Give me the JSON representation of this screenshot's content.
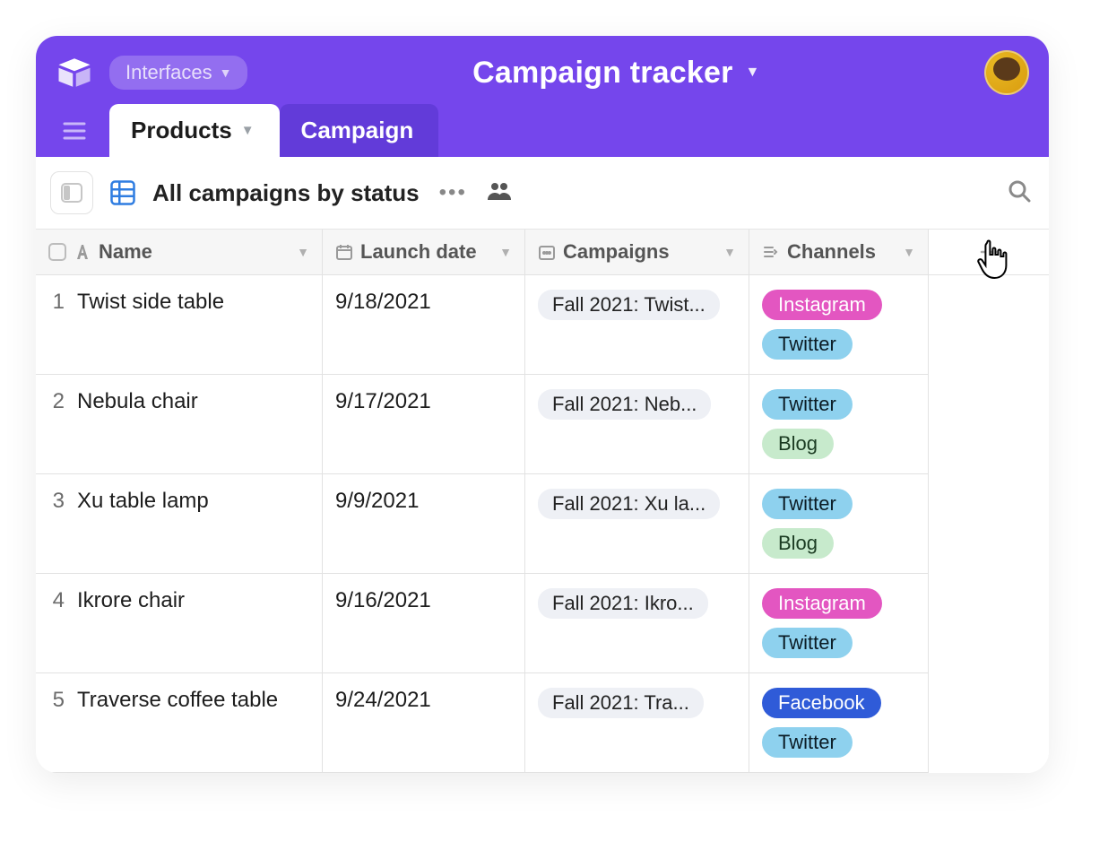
{
  "header": {
    "interfaces_label": "Interfaces",
    "title": "Campaign tracker"
  },
  "tabs": [
    {
      "label": "Products",
      "active": true
    },
    {
      "label": "Campaign",
      "active": false
    }
  ],
  "toolbar": {
    "view_name": "All campaigns by status"
  },
  "columns": {
    "name": "Name",
    "launch_date": "Launch date",
    "campaigns": "Campaigns",
    "channels": "Channels"
  },
  "channel_styles": {
    "Instagram": "instagram",
    "Twitter": "twitter",
    "Blog": "blog",
    "Facebook": "facebook"
  },
  "rows": [
    {
      "num": "1",
      "name": "Twist side table",
      "launch_date": "9/18/2021",
      "campaign": "Fall 2021: Twist...",
      "channels": [
        "Instagram",
        "Twitter"
      ]
    },
    {
      "num": "2",
      "name": "Nebula chair",
      "launch_date": "9/17/2021",
      "campaign": "Fall 2021: Neb...",
      "channels": [
        "Twitter",
        "Blog"
      ]
    },
    {
      "num": "3",
      "name": "Xu table lamp",
      "launch_date": "9/9/2021",
      "campaign": "Fall 2021: Xu la...",
      "channels": [
        "Twitter",
        "Blog"
      ]
    },
    {
      "num": "4",
      "name": "Ikrore chair",
      "launch_date": "9/16/2021",
      "campaign": "Fall 2021: Ikro...",
      "channels": [
        "Instagram",
        "Twitter"
      ]
    },
    {
      "num": "5",
      "name": "Traverse coffee table",
      "launch_date": "9/24/2021",
      "campaign": "Fall 2021: Tra...",
      "channels": [
        "Facebook",
        "Twitter"
      ]
    }
  ]
}
